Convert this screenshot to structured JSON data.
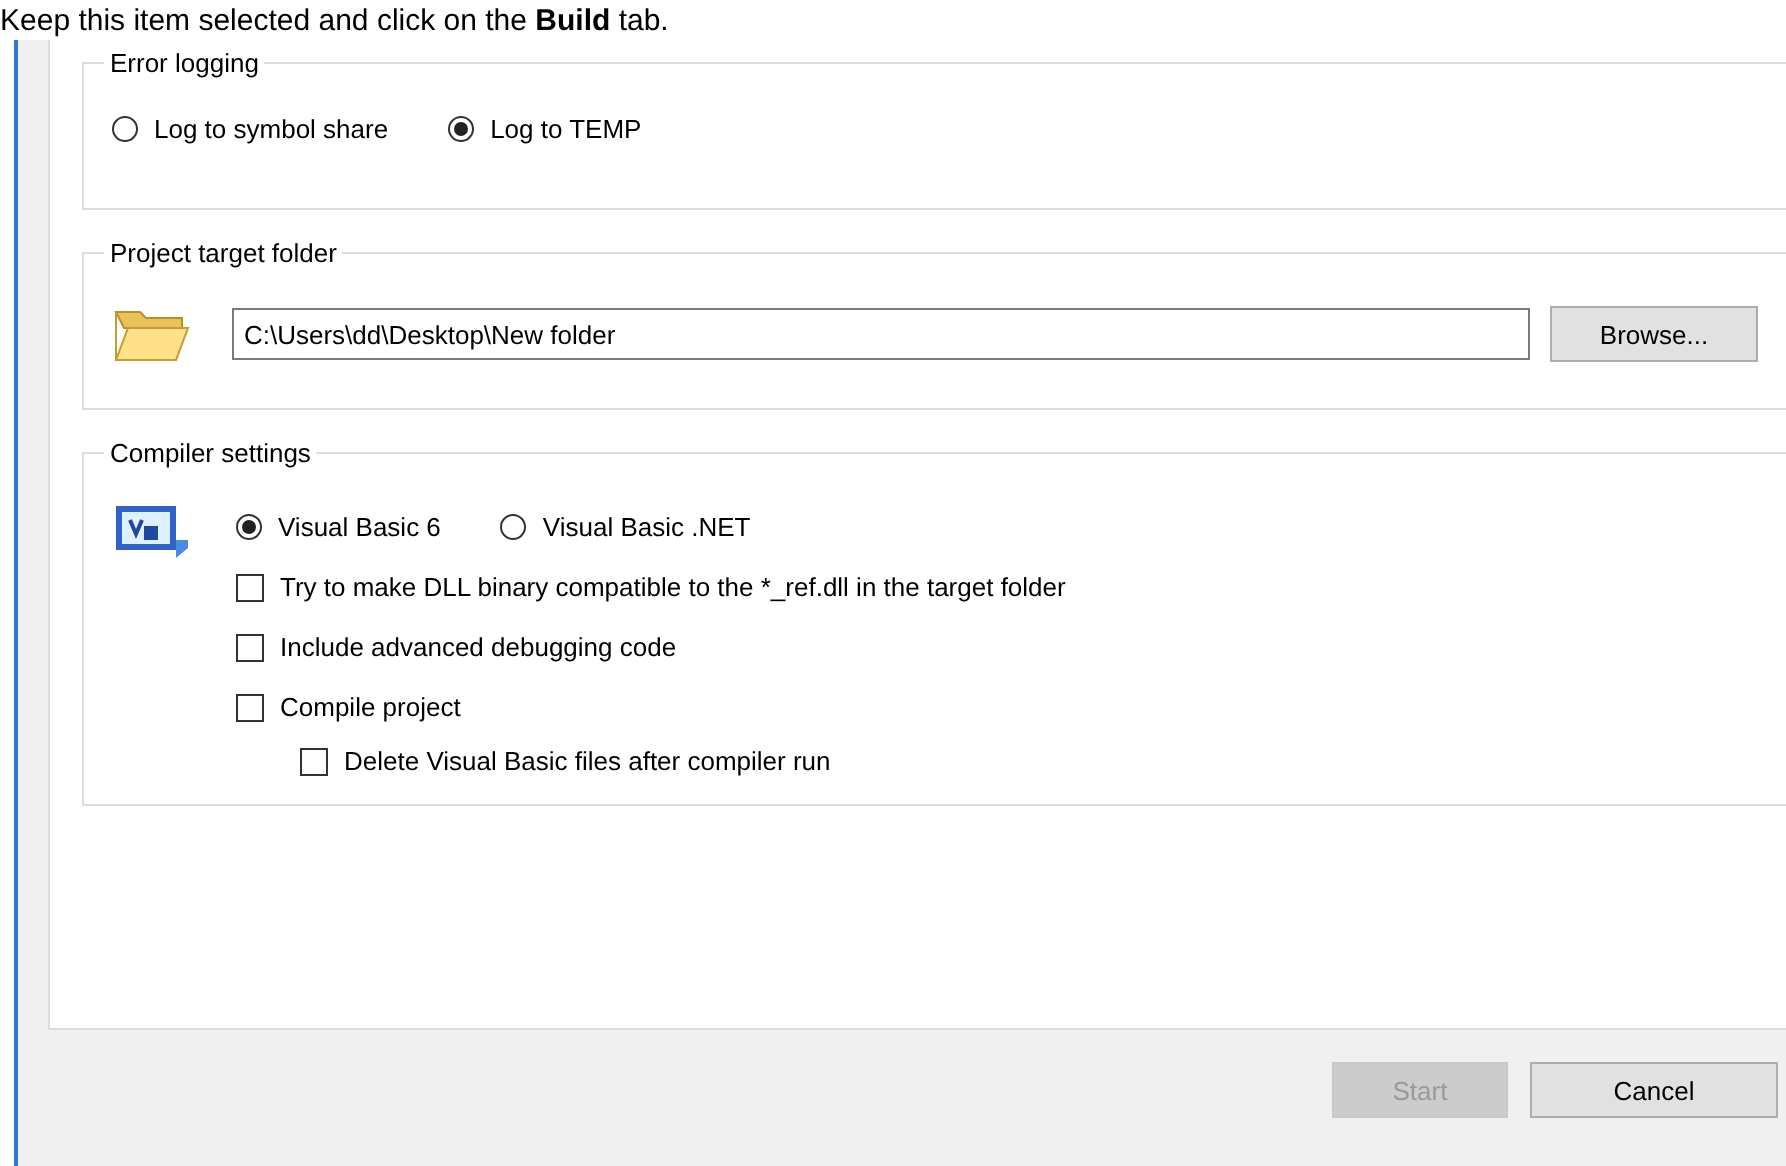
{
  "instruction": "Keep this item selected and click on the **Build** tab.",
  "error_logging": {
    "title": "Error logging",
    "options": [
      {
        "label": "Log to symbol share",
        "selected": false
      },
      {
        "label": "Log to TEMP",
        "selected": true
      }
    ]
  },
  "target_folder": {
    "title": "Project target folder",
    "path": "C:\\Users\\dd\\Desktop\\New folder",
    "browse": "Browse..."
  },
  "compiler": {
    "title": "Compiler settings",
    "versions": [
      {
        "label": "Visual Basic 6",
        "selected": true
      },
      {
        "label": "Visual Basic .NET",
        "selected": false
      }
    ],
    "options": [
      {
        "label": "Try to make DLL binary compatible to the *_ref.dll in the target folder",
        "checked": false
      },
      {
        "label": "Include advanced debugging code",
        "checked": false
      },
      {
        "label": "Compile project",
        "checked": false,
        "children": [
          {
            "label": "Delete Visual Basic files after compiler run",
            "checked": false
          }
        ]
      }
    ]
  },
  "buttons": [
    {
      "label": "Start",
      "disabled": true
    },
    {
      "label": "Cancel",
      "disabled": false
    }
  ]
}
